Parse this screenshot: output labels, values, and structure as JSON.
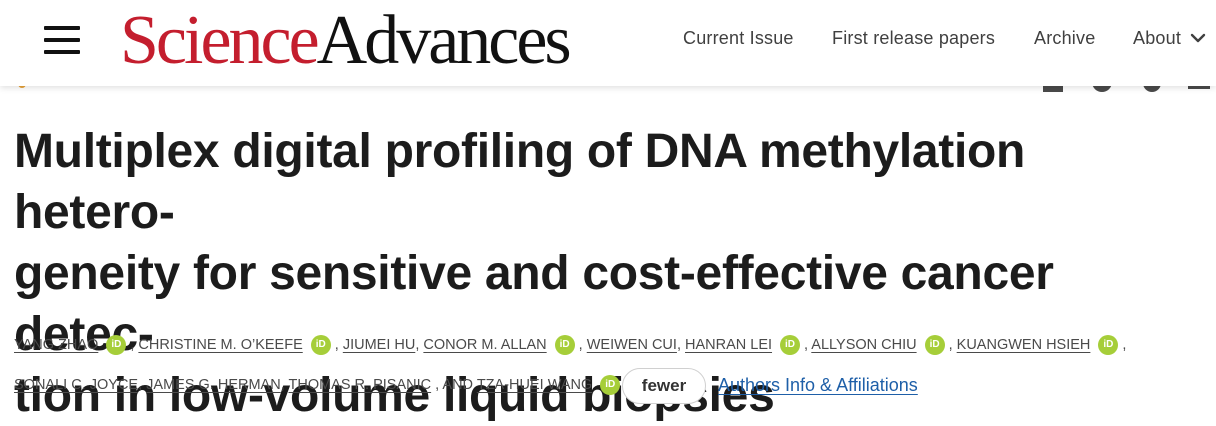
{
  "header": {
    "logo": {
      "science": "Science",
      "advances": "Advances"
    },
    "nav": {
      "current_issue": "Current Issue",
      "first_release": "First release papers",
      "archive": "Archive",
      "about": "About"
    },
    "colors": {
      "logo_red": "#c41e2e",
      "orcid_green": "#a6ce39",
      "link_blue": "#1e5fa8"
    }
  },
  "article": {
    "title": "Multiplex digital profiling of DNA methylation hetero-geneity for sensitive and cost-effective cancer detec-tion in low-volume liquid biopsies",
    "title_lines": [
      "Multiplex digital profiling of DNA methylation hetero-",
      "geneity for sensitive and cost-effective cancer detec-",
      "tion in low-volume liquid biopsies"
    ],
    "authors": [
      {
        "name": "YANG ZHAO",
        "orcid": true
      },
      {
        "name": "CHRISTINE M. O’KEEFE",
        "orcid": true
      },
      {
        "name": "JIUMEI HU",
        "orcid": false
      },
      {
        "name": "CONOR M. ALLAN",
        "orcid": true
      },
      {
        "name": "WEIWEN CUI",
        "orcid": false
      },
      {
        "name": "HANRAN LEI",
        "orcid": true
      },
      {
        "name": "ALLYSON CHIU",
        "orcid": true
      },
      {
        "name": "KUANGWEN HSIEH",
        "orcid": true
      },
      {
        "name": "SONALI C. JOYCE",
        "orcid": false
      },
      {
        "name": "JAMES G. HERMAN",
        "orcid": false
      },
      {
        "name": "THOMAS R. PISANIC",
        "orcid": false
      },
      {
        "name": "TZA-HUEI WANG",
        "orcid": true
      }
    ],
    "orcid_label": "iD",
    "and_text": "AND",
    "fewer_button": "fewer",
    "affiliations_link": "Authors Info & Affiliations"
  }
}
